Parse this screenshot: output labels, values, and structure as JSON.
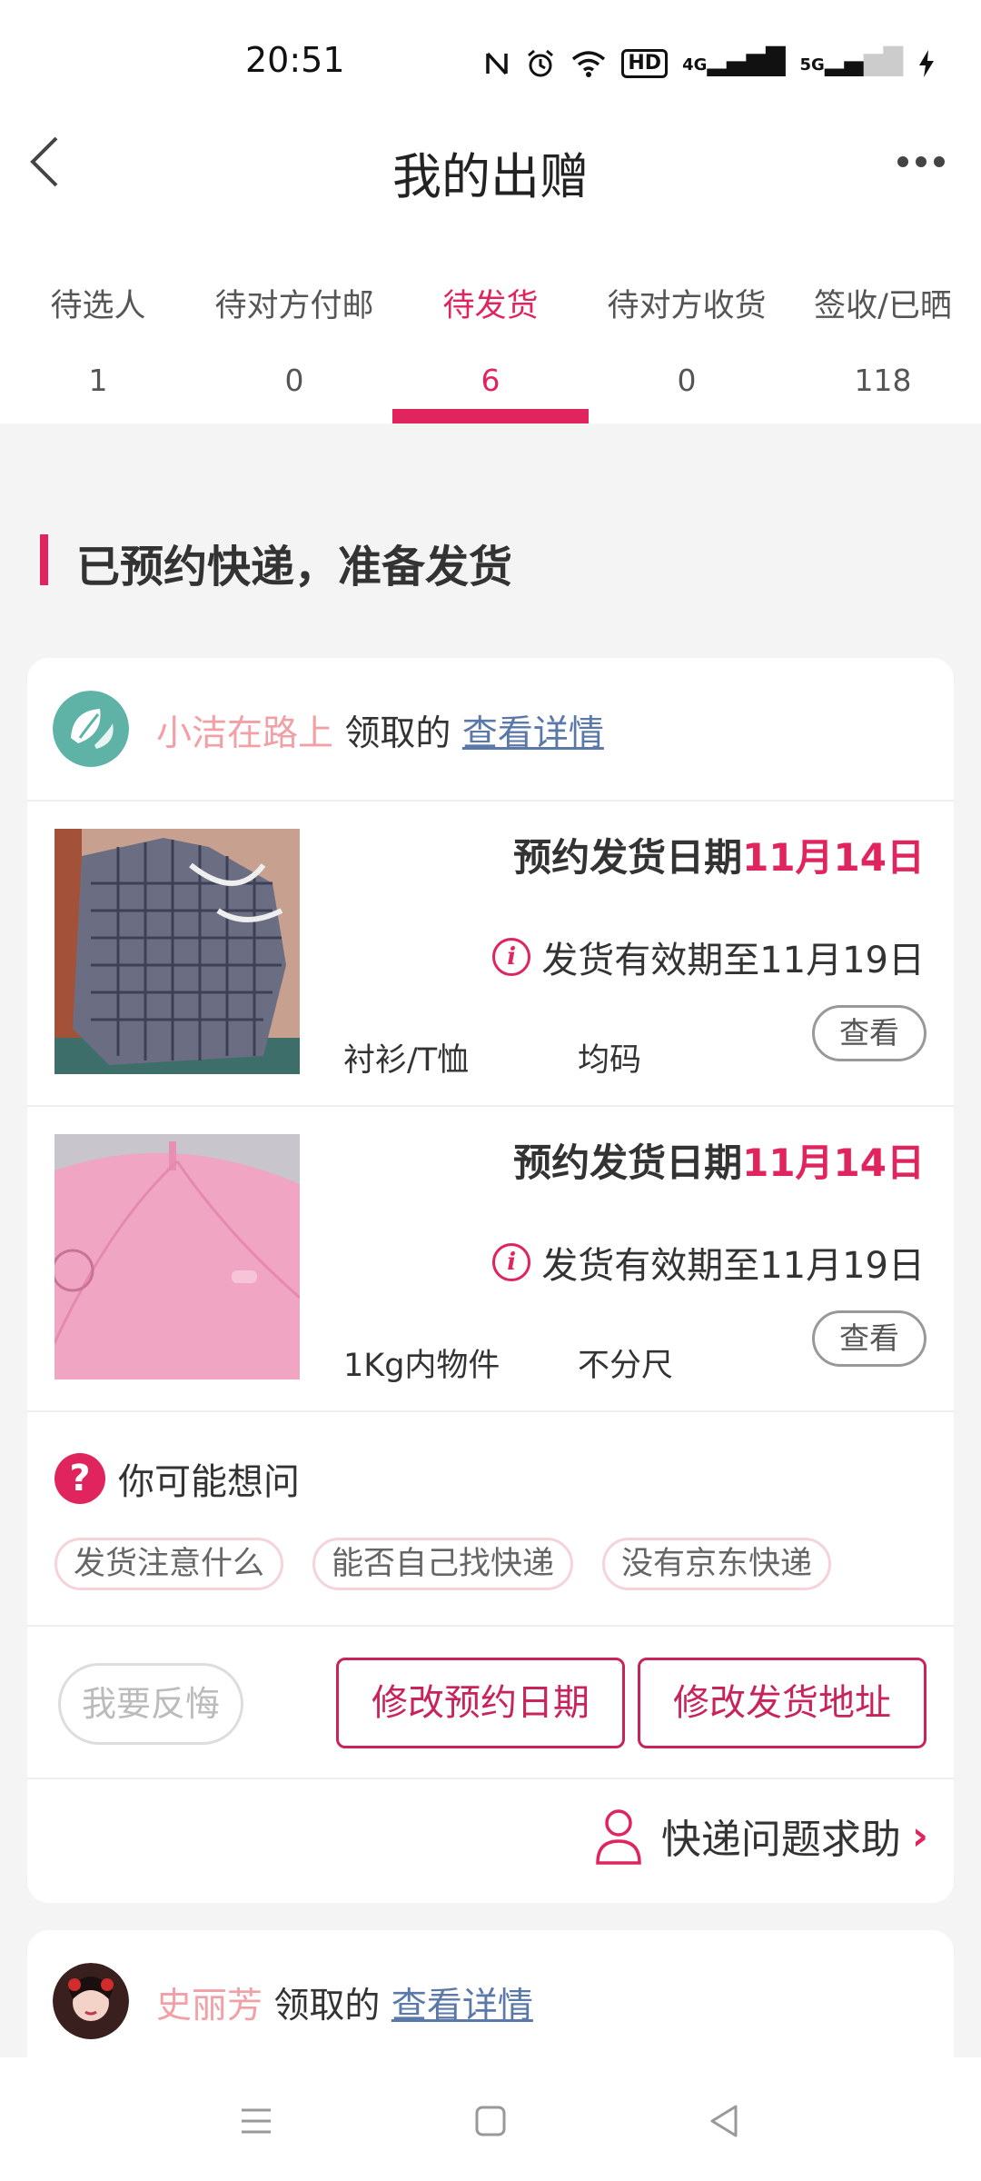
{
  "status_bar": {
    "time": "20:51",
    "hd_badge": "HD",
    "net1": "4G",
    "net2": "5G",
    "icons": [
      "nfc-icon",
      "alarm-icon",
      "wifi-icon",
      "hd-icon",
      "signal-4g-icon",
      "signal-5g-icon",
      "charging-icon"
    ]
  },
  "header": {
    "title": "我的出赠",
    "back_icon": "back-arrow-icon",
    "more_icon": "more-dots-icon"
  },
  "tabs": [
    {
      "label": "待选人",
      "count": "1"
    },
    {
      "label": "待对方付邮",
      "count": "0"
    },
    {
      "label": "待发货",
      "count": "6",
      "active": true
    },
    {
      "label": "待对方收货",
      "count": "0"
    },
    {
      "label": "签收/已晒",
      "count": "118"
    }
  ],
  "section": {
    "title": "已预约快递，准备发货"
  },
  "orders": [
    {
      "recipient": {
        "name": "小洁在路上",
        "received": "领取的",
        "details_link": "查看详情"
      },
      "items": [
        {
          "date_prefix": "预约发货日期",
          "date": "11月14日",
          "validity": "发货有效期至11月19日",
          "category": "衬衫/T恤",
          "size": "均码",
          "view": "查看",
          "image": "gray-plaid-shirt-photo"
        },
        {
          "date_prefix": "预约发货日期",
          "date": "11月14日",
          "validity": "发货有效期至11月19日",
          "category": "1Kg内物件",
          "size": "不分尺",
          "view": "查看",
          "image": "pink-umbrella-photo"
        }
      ],
      "faq": {
        "title": "你可能想问",
        "chips": [
          "发货注意什么",
          "能否自己找快递",
          "没有京东快递"
        ]
      },
      "actions": {
        "regret": "我要反悔",
        "change_date": "修改预约日期",
        "change_address": "修改发货地址"
      },
      "help": {
        "label": "快递问题求助"
      }
    },
    {
      "recipient": {
        "name": "史丽芳",
        "received": "领取的",
        "details_link": "查看详情"
      }
    }
  ],
  "colors": {
    "accent": "#e0245e",
    "recipient_name": "#f2a0a5",
    "link": "#5a78a8",
    "background": "#f4f4f4"
  }
}
